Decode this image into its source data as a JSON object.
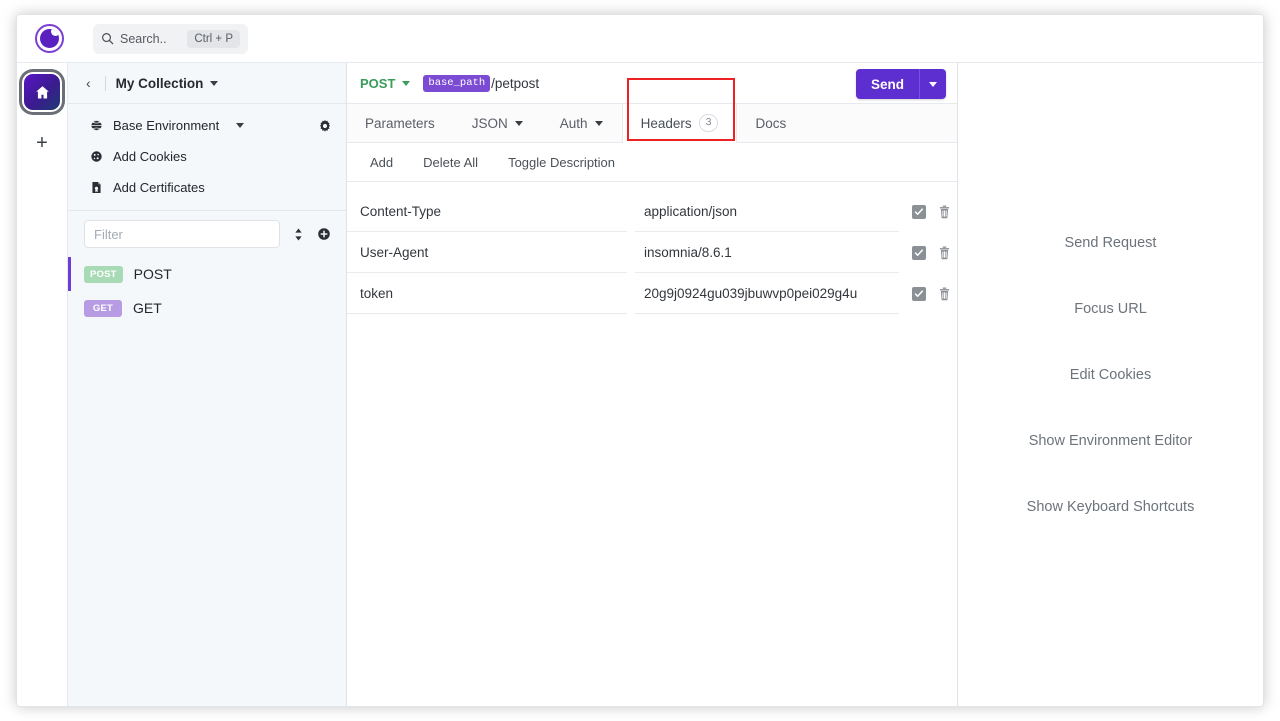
{
  "app": {
    "logo_icon": "insomnia-logo-icon"
  },
  "topbar": {
    "search": {
      "placeholder": "Search..",
      "shortcut": "Ctrl + P",
      "icon": "search-icon"
    }
  },
  "rail": {
    "home_icon": "home-icon",
    "add_label": "+"
  },
  "sidebar": {
    "back_icon": "chevron-left-icon",
    "collection_name": "My Collection",
    "environment": {
      "label": "Base Environment",
      "icon": "globe-icon",
      "settings_icon": "gear-icon"
    },
    "links": [
      {
        "label": "Add Cookies",
        "icon": "cookie-icon"
      },
      {
        "label": "Add Certificates",
        "icon": "certificate-icon"
      }
    ],
    "filter": {
      "placeholder": "Filter",
      "sort_icon": "sort-icon",
      "add_icon": "plus-circle-icon"
    },
    "requests": [
      {
        "method": "POST",
        "name": "POST",
        "active": true
      },
      {
        "method": "GET",
        "name": "GET",
        "active": false
      }
    ]
  },
  "request": {
    "method": "POST",
    "url_tag": "base_path",
    "url_path": "/petpost",
    "send_label": "Send",
    "send_caret_icon": "chevron-down-icon",
    "tabs": [
      {
        "label": "Parameters",
        "count": null,
        "caret": false,
        "active": false
      },
      {
        "label": "JSON",
        "count": null,
        "caret": true,
        "active": false
      },
      {
        "label": "Auth",
        "count": null,
        "caret": true,
        "active": false
      },
      {
        "label": "Headers",
        "count": "3",
        "caret": false,
        "active": true
      },
      {
        "label": "Docs",
        "count": null,
        "caret": false,
        "active": false
      }
    ],
    "actions": [
      "Add",
      "Delete All",
      "Toggle Description"
    ],
    "headers_columns": [
      "name",
      "value"
    ],
    "headers": [
      {
        "name": "Content-Type",
        "value": "application/json",
        "enabled": true
      },
      {
        "name": "User-Agent",
        "value": "insomnia/8.6.1",
        "enabled": true
      },
      {
        "name": "token",
        "value": "20g9j0924gu039jbuwvp0pei029g4u",
        "enabled": true
      }
    ],
    "row_icons": {
      "checkbox": "checkbox-checked-icon",
      "delete": "trash-icon"
    }
  },
  "right_panel": {
    "shortcuts": [
      "Send Request",
      "Focus URL",
      "Edit Cookies",
      "Show Environment Editor",
      "Show Keyboard Shortcuts"
    ]
  },
  "colors": {
    "accent_purple": "#5d2fd0",
    "method_post_green": "#3a9c5a",
    "badge_post_bg": "#a9dab6",
    "badge_get_bg": "#b79ce4",
    "highlight_red": "#ee2222",
    "sidebar_bg": "#f5f8fa"
  }
}
